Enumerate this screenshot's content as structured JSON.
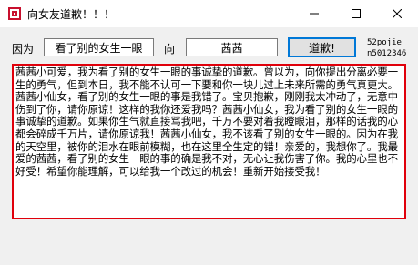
{
  "window": {
    "title": "向女友道歉！！！"
  },
  "form": {
    "because_label": "因为",
    "reason_value": "看了别的女生一眼",
    "to_label": "向",
    "name_value": "茜茜",
    "apology_button_label": "道歉!",
    "signature_line1": "52pojie",
    "signature_line2": "n5012346"
  },
  "message": {
    "text": "茜茜小可爱，我为看了别的女生一眼的事诚挚的道歉。曾以为，向你提出分离必要一生的勇气，但到本日，我不能不认可一下要和你一块儿过上未来所需的勇气真更大。茜茜小仙女，看了别的女生一眼的事是我错了。宝贝抱歉，刚刚我太冲动了，无意中伤到了你，请你原谅！这样的我你还爱我吗？茜茜小仙女，我为看了别的女生一眼的事诚挚的道歉。如果你生气就直接骂我吧，千万不要对着我瞪眼泪，那样的话我的心都会碎成千万片，请你原谅我！茜茜小仙女，我不该看了别的女生一眼的。因为在我的天空里，被你的泪水在眼前模糊，也在这里全生定的错！亲爱的，我想你了。我最爱的茜茜，看了别的女生一眼的事的确是我不对，无心让我伤害了你。我的心里也不好受！希望你能理解，可以给我一个改过的机会！重新开始接受我！"
  },
  "colors": {
    "message_border": "#e0000b",
    "button_focus_border": "#0078d7",
    "client_background": "#f0f0f0"
  },
  "icons": {
    "app": "app-icon",
    "minimize": "minimize-icon",
    "maximize": "maximize-icon",
    "close": "close-icon"
  }
}
